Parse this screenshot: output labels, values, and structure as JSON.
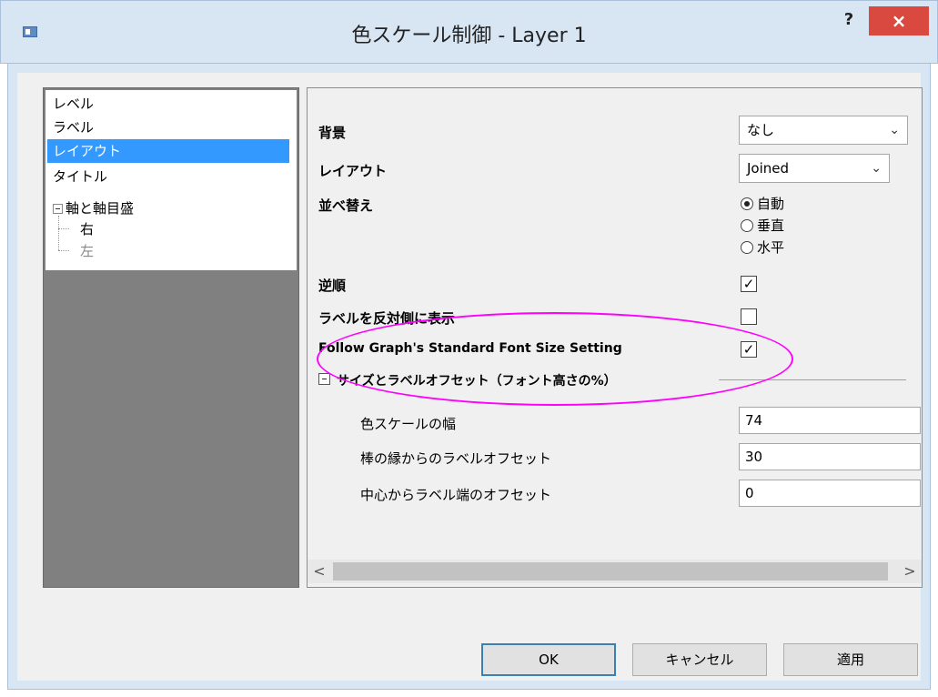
{
  "window": {
    "title": "色スケール制御 - Layer 1",
    "help_label": "?",
    "close_label": "×"
  },
  "tree": {
    "items": [
      {
        "label": "レベル",
        "selected": false
      },
      {
        "label": "ラベル",
        "selected": false
      },
      {
        "label": "レイアウト",
        "selected": true
      },
      {
        "label": "タイトル",
        "selected": false
      },
      {
        "label": "軸と軸目盛",
        "selected": false
      },
      {
        "label": "右",
        "selected": false
      },
      {
        "label": "左",
        "selected": false
      }
    ]
  },
  "properties": {
    "background_label": "背景",
    "background_value": "なし",
    "layout_label": "レイアウト",
    "layout_value": "Joined",
    "order_label": "並べ替え",
    "order_options": [
      "自動",
      "垂直",
      "水平"
    ],
    "order_selected": "自動",
    "reverse_label": "逆順",
    "reverse_checked": true,
    "reverse_mark": "✓",
    "opposite_label": "ラベルを反対側に表示",
    "opposite_checked": false,
    "follow_label": "Follow Graph's Standard Font Size Setting",
    "follow_checked": true,
    "follow_mark": "✓",
    "group_label": "サイズとラベルオフセット（フォント高さの%）",
    "width_label": "色スケールの幅",
    "width_value": "74",
    "bar_offset_label": "棒の縁からのラベルオフセット",
    "bar_offset_value": "30",
    "center_offset_label": "中心からラベル端のオフセット",
    "center_offset_value": "0"
  },
  "scrollbar": {
    "left_arrow": "<",
    "right_arrow": ">"
  },
  "buttons": {
    "ok": "OK",
    "cancel": "キャンセル",
    "apply": "適用"
  },
  "colors": {
    "selection": "#3399ff",
    "highlight": "#ff00ff",
    "close": "#d9493f"
  }
}
